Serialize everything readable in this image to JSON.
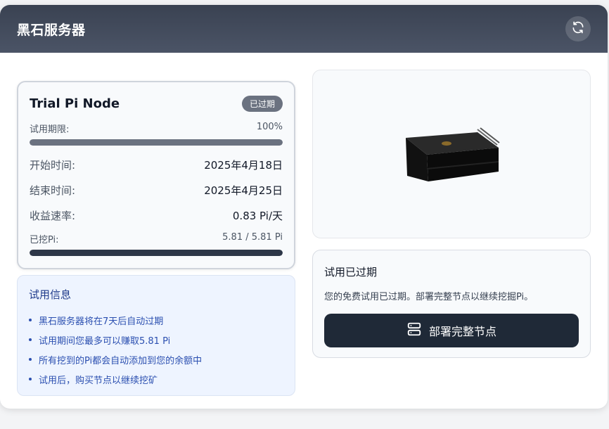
{
  "header": {
    "title": "黑石服务器",
    "refresh_icon": "refresh-icon"
  },
  "node": {
    "title": "Trial Pi Node",
    "status_badge": "已过期",
    "trial_period_label": "试用期限:",
    "trial_period_value": "100%",
    "trial_period_fraction": 1.0,
    "start_label": "开始时间:",
    "start_value": "2025年4月18日",
    "end_label": "结束时间:",
    "end_value": "2025年4月25日",
    "rate_label": "收益速率:",
    "rate_value": "0.83 Pi/天",
    "mined_label": "已挖Pi:",
    "mined_value": "5.81 / 5.81 Pi",
    "mined_fraction": 1.0
  },
  "trial_info": {
    "title": "试用信息",
    "items": [
      "黑石服务器将在7天后自动过期",
      "试用期间您最多可以赚取5.81 Pi",
      "所有挖到的Pi都会自动添加到您的余额中",
      "试用后，购买节点以继续挖矿"
    ]
  },
  "expired": {
    "title": "试用已过期",
    "description": "您的免费试用已过期。部署完整节点以继续挖掘Pi。",
    "deploy_button": "部署完整节点",
    "deploy_icon": "server-icon"
  },
  "colors": {
    "header_bg": "#3a4252",
    "badge_bg": "#6b7280",
    "progress_gray": "#6b7280",
    "progress_dark": "#2d3748",
    "info_bg": "#eef4ff",
    "info_text": "#2b4fb0",
    "button_bg": "#1f2937"
  }
}
